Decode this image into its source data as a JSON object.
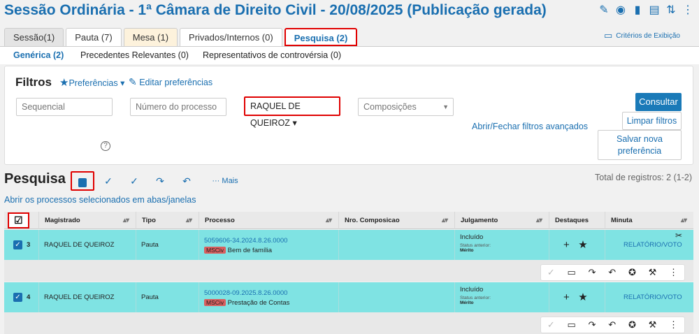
{
  "header": {
    "title": "Sessão Ordinária - 1ª Câmara de Direito Civil - 20/08/2025 (Publicação gerada)",
    "icons": [
      "pencil-icon",
      "broadcast-icon",
      "door-icon",
      "file-plus-icon",
      "sort-arrows-icon",
      "more-vertical-icon"
    ]
  },
  "tabs": [
    {
      "label": "Sessão(1)"
    },
    {
      "label": "Pauta (7)"
    },
    {
      "label": "Mesa (1)"
    },
    {
      "label": "Privados/Internos (0)"
    },
    {
      "label": "Pesquisa (2)"
    }
  ],
  "criteria_link": "Critérios de Exibição",
  "subtabs": [
    {
      "label": "Genérica (2)"
    },
    {
      "label": "Precedentes Relevantes (0)"
    },
    {
      "label": "Representativos de controvérsia (0)"
    }
  ],
  "filters": {
    "title": "Filtros",
    "preferences": "Preferências",
    "edit_preferences": "Editar preferências",
    "sequencial_placeholder": "Sequencial",
    "processo_placeholder": "Número do processo",
    "magistrado_value": "RAQUEL DE QUEIROZ",
    "composicoes_placeholder": "Composições",
    "toggle_advanced": "Abrir/Fechar filtros avançados",
    "consultar": "Consultar",
    "limpar": "Limpar filtros",
    "salvar": "Salvar nova preferência",
    "help": "?"
  },
  "search": {
    "title": "Pesquisa",
    "more": "··· Mais",
    "total": "Total de registros: 2 (1-2)",
    "open_link": "Abrir os processos selecionados em abas/janelas"
  },
  "table": {
    "headers": [
      "Magistrado",
      "Tipo",
      "Processo",
      "Nro. Composicao",
      "Julgamento",
      "Destaques",
      "Minuta"
    ],
    "rows": [
      {
        "seq": "3",
        "magistrado": "RAQUEL DE QUEIROZ",
        "tipo": "Pauta",
        "processo": "5059606-34.2024.8.26.0000",
        "tag": "MSCiv",
        "assunto": "Bem de família",
        "julgamento": "Incluído",
        "status_label": "Status anterior:",
        "status_value": "Mérito",
        "minuta": "RELATÓRIO/VOTO"
      },
      {
        "seq": "4",
        "magistrado": "RAQUEL DE QUEIROZ",
        "tipo": "Pauta",
        "processo": "5000028-09.2025.8.26.0000",
        "tag": "MSCiv",
        "assunto": "Prestação de Contas",
        "julgamento": "Incluído",
        "status_label": "Status anterior:",
        "status_value": "Mérito",
        "minuta": "RELATÓRIO/VOTO"
      }
    ]
  },
  "colors": {
    "accent": "#1a6fb0",
    "row_highlight": "#7fe3e3",
    "focus_box": "#e00000",
    "tag": "#d95f5f"
  }
}
